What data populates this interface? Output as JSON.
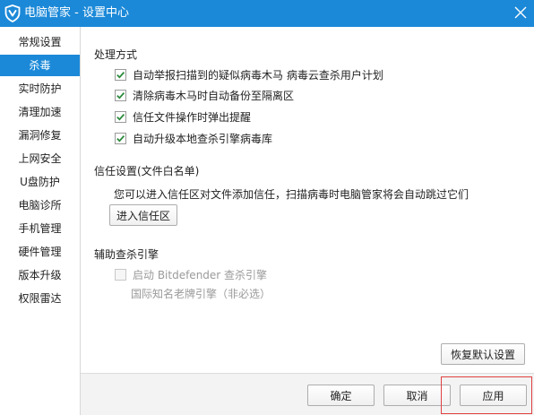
{
  "window": {
    "title": "电脑管家 - 设置中心",
    "accent_color": "#1b89d8",
    "close_icon": "close-icon",
    "logo_icon": "shield-logo-icon"
  },
  "sidebar": {
    "items": [
      {
        "label": "常规设置",
        "active": false
      },
      {
        "label": "杀毒",
        "active": true
      },
      {
        "label": "实时防护",
        "active": false
      },
      {
        "label": "清理加速",
        "active": false
      },
      {
        "label": "漏洞修复",
        "active": false
      },
      {
        "label": "上网安全",
        "active": false
      },
      {
        "label": "U盘防护",
        "active": false
      },
      {
        "label": "电脑诊所",
        "active": false
      },
      {
        "label": "手机管理",
        "active": false
      },
      {
        "label": "硬件管理",
        "active": false
      },
      {
        "label": "版本升级",
        "active": false
      },
      {
        "label": "权限雷达",
        "active": false
      }
    ]
  },
  "main": {
    "processing": {
      "title": "处理方式",
      "options": [
        {
          "label": "自动举报扫描到的疑似病毒木马  病毒云查杀用户计划",
          "checked": true
        },
        {
          "label": "清除病毒木马时自动备份至隔离区",
          "checked": true
        },
        {
          "label": "信任文件操作时弹出提醒",
          "checked": true
        },
        {
          "label": "自动升级本地查杀引擎病毒库",
          "checked": true
        }
      ]
    },
    "trust": {
      "title": "信任设置(文件白名单)",
      "description": "您可以进入信任区对文件添加信任，扫描病毒时电脑管家将会自动跳过它们",
      "button_label": "进入信任区"
    },
    "engine": {
      "title": "辅助查杀引擎",
      "option_label": "启动 Bitdefender 查杀引擎",
      "option_checked": false,
      "option_disabled": true,
      "note": "国际知名老牌引擎（非必选）"
    },
    "restore_label": "恢复默认设置"
  },
  "footer": {
    "ok_label": "确定",
    "cancel_label": "取消",
    "apply_label": "应用"
  }
}
